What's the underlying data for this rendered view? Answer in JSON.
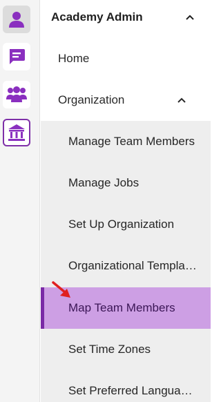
{
  "rail": {
    "items": [
      {
        "name": "profile",
        "icon": "person-icon"
      },
      {
        "name": "chat",
        "icon": "chat-icon"
      },
      {
        "name": "team",
        "icon": "people-icon"
      },
      {
        "name": "academy",
        "icon": "academy-icon"
      }
    ]
  },
  "nav": {
    "header": "Academy Admin",
    "items": [
      {
        "label": "Home"
      },
      {
        "label": "Organization"
      }
    ],
    "sub_items": [
      {
        "label": "Manage Team Members"
      },
      {
        "label": "Manage Jobs"
      },
      {
        "label": "Set Up Organization"
      },
      {
        "label": "Organizational Templates"
      },
      {
        "label": "Map Team Members",
        "selected": true
      },
      {
        "label": "Set Time Zones"
      },
      {
        "label": "Set Preferred Languages"
      }
    ]
  },
  "colors": {
    "accent": "#7e2fa8",
    "selected_bg": "#cd9fe4",
    "annotation_arrow": "#e02020"
  }
}
